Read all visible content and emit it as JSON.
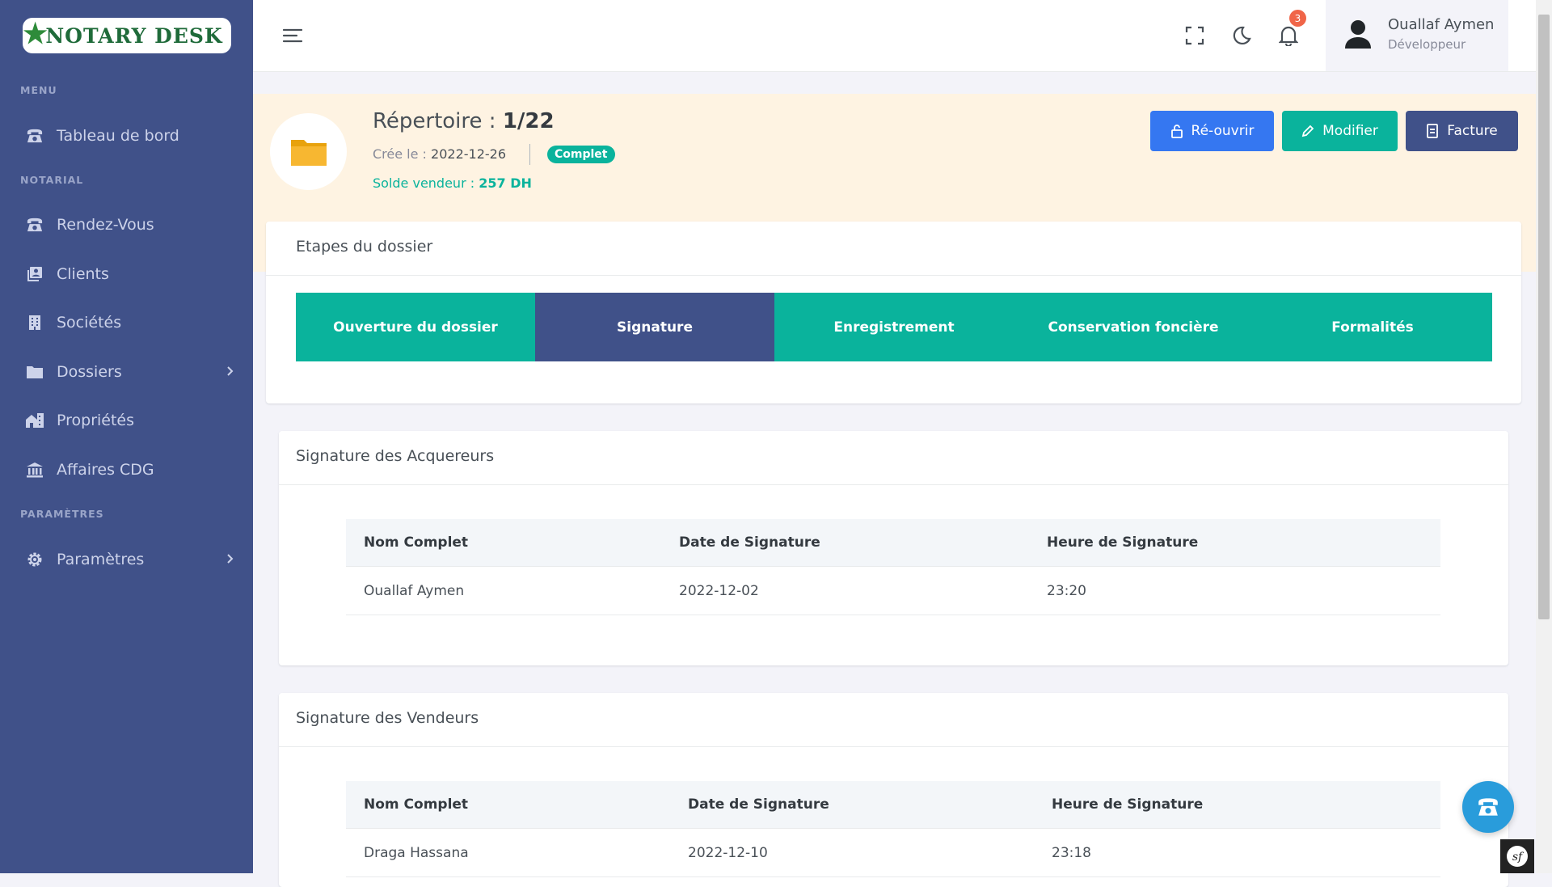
{
  "app": {
    "logo": "NOTARY DESK"
  },
  "sidebar": {
    "sections": [
      {
        "title": "MENU"
      },
      {
        "title": "NOTARIAL"
      },
      {
        "title": "PARAMÈTRES"
      }
    ],
    "items": [
      {
        "label": "Tableau de bord",
        "icon": "phone-icon"
      },
      {
        "label": "Rendez-Vous",
        "icon": "phone-icon"
      },
      {
        "label": "Clients",
        "icon": "contacts-icon"
      },
      {
        "label": "Sociétés",
        "icon": "building-icon"
      },
      {
        "label": "Dossiers",
        "icon": "folder-icon"
      },
      {
        "label": "Propriétés",
        "icon": "property-icon"
      },
      {
        "label": "Affaires CDG",
        "icon": "bank-icon"
      },
      {
        "label": "Paramètres",
        "icon": "gear-icon"
      }
    ]
  },
  "topbar": {
    "notification_count": "3",
    "user": {
      "name": "Ouallaf Aymen",
      "role": "Développeur"
    }
  },
  "dossier": {
    "title_prefix": "Répertoire : ",
    "number": "1/22",
    "created_label": "Crée le : ",
    "created_date": "2022-12-26",
    "status": "Complet",
    "solde_label": "Solde vendeur : ",
    "solde_value": "257 DH",
    "actions": {
      "reopen": "Ré-ouvrir",
      "edit": "Modifier",
      "invoice": "Facture"
    }
  },
  "steps_card": {
    "title": "Etapes du dossier",
    "steps": [
      "Ouverture du dossier",
      "Signature",
      "Enregistrement",
      "Conservation foncière",
      "Formalités"
    ],
    "active_step": "Signature"
  },
  "acquereurs": {
    "title": "Signature des Acquereurs",
    "columns": [
      "Nom Complet",
      "Date de Signature",
      "Heure de Signature"
    ],
    "rows": [
      [
        "Ouallaf Aymen",
        "2022-12-02",
        "23:20"
      ]
    ]
  },
  "vendeurs": {
    "title": "Signature des Vendeurs",
    "columns": [
      "Nom Complet",
      "Date de Signature",
      "Heure de Signature"
    ],
    "rows": [
      [
        "Draga Hassana",
        "2022-12-10",
        "23:18"
      ]
    ]
  },
  "colors": {
    "sidebar": "#405189",
    "primary_blue": "#3577f1",
    "success": "#0ab39c",
    "dark_blue": "#405189",
    "header_bg": "#fef3e2",
    "info": "#299cdb"
  }
}
